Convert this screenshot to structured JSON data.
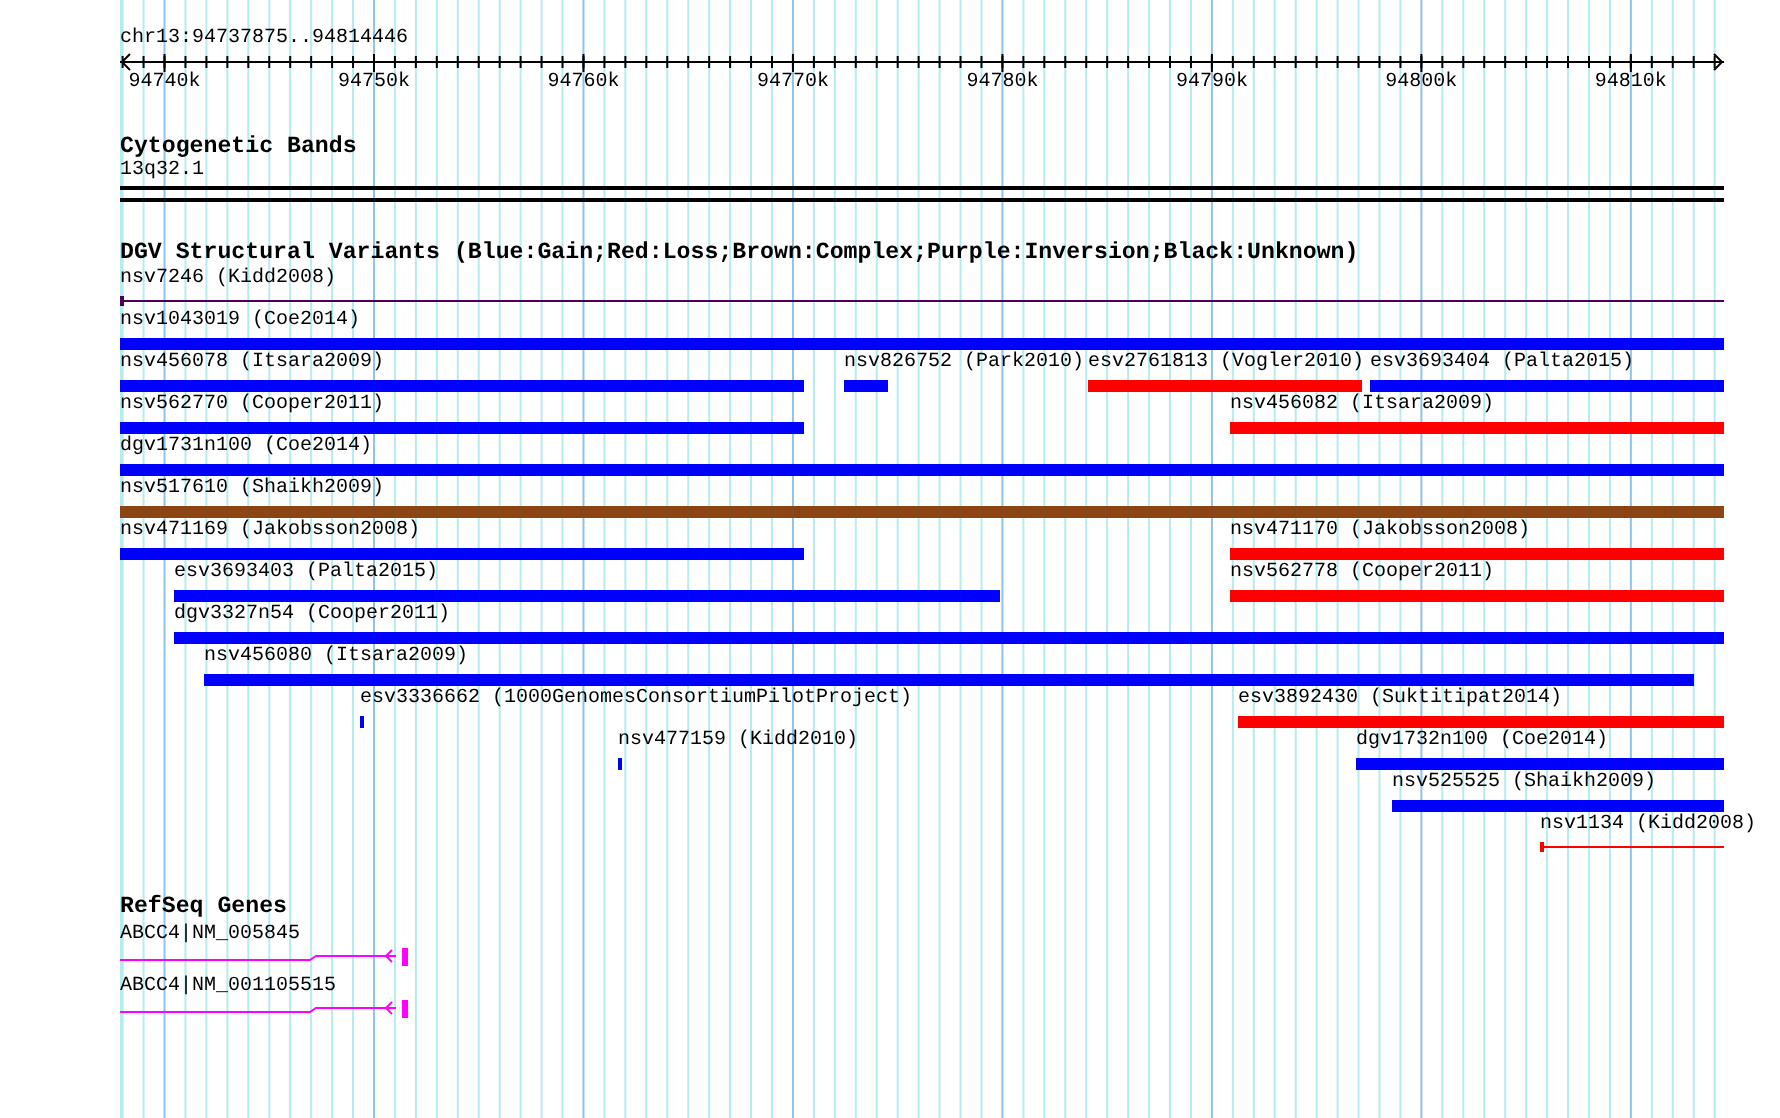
{
  "ruler": {
    "region": "chr13:94737875..94814446",
    "ticks": [
      {
        "label": "94740k"
      },
      {
        "label": "94750k"
      },
      {
        "label": "94760k"
      },
      {
        "label": "94770k"
      },
      {
        "label": "94780k"
      },
      {
        "label": "94790k"
      },
      {
        "label": "94800k"
      },
      {
        "label": "94810k"
      }
    ]
  },
  "cytogenetic_bands": {
    "title": "Cytogenetic Bands",
    "bands": [
      {
        "name": "13q32.1"
      }
    ]
  },
  "dgv": {
    "title": "DGV Structural Variants (Blue:Gain;Red:Loss;Brown:Complex;Purple:Inversion;Black:Unknown)",
    "rows": [
      {
        "features": [
          {
            "label": "nsv7246 (Kidd2008)",
            "kind": "line",
            "color": "#4b0055"
          }
        ]
      },
      {
        "features": [
          {
            "label": "nsv1043019 (Coe2014)",
            "kind": "bar",
            "color": "#0000ff"
          }
        ]
      },
      {
        "features": [
          {
            "label": "nsv456078 (Itsara2009)",
            "kind": "bar",
            "color": "#0000ff"
          },
          {
            "label": "nsv826752 (Park2010)",
            "kind": "bar",
            "color": "#0000ff"
          },
          {
            "label": "esv2761813 (Vogler2010)",
            "kind": "bar",
            "color": "#ff0000"
          },
          {
            "label": "esv3693404 (Palta2015)",
            "kind": "bar",
            "color": "#0000ff"
          }
        ]
      },
      {
        "features": [
          {
            "label": "nsv562770 (Cooper2011)",
            "kind": "bar",
            "color": "#0000ff"
          },
          {
            "label": "nsv456082 (Itsara2009)",
            "kind": "bar",
            "color": "#ff0000"
          }
        ]
      },
      {
        "features": [
          {
            "label": "dgv1731n100 (Coe2014)",
            "kind": "bar",
            "color": "#0000ff"
          }
        ]
      },
      {
        "features": [
          {
            "label": "nsv517610 (Shaikh2009)",
            "kind": "bar",
            "color": "#8b4513"
          }
        ]
      },
      {
        "features": [
          {
            "label": "nsv471169 (Jakobsson2008)",
            "kind": "bar",
            "color": "#0000ff"
          },
          {
            "label": "nsv471170 (Jakobsson2008)",
            "kind": "bar",
            "color": "#ff0000"
          }
        ]
      },
      {
        "features": [
          {
            "label": "esv3693403 (Palta2015)",
            "kind": "bar",
            "color": "#0000ff"
          },
          {
            "label": "nsv562778 (Cooper2011)",
            "kind": "bar",
            "color": "#ff0000"
          }
        ]
      },
      {
        "features": [
          {
            "label": "dgv3327n54 (Cooper2011)",
            "kind": "bar",
            "color": "#0000ff"
          }
        ]
      },
      {
        "features": [
          {
            "label": "nsv456080 (Itsara2009)",
            "kind": "bar",
            "color": "#0000ff"
          }
        ]
      },
      {
        "features": [
          {
            "label": "esv3336662 (1000GenomesConsortiumPilotProject)",
            "kind": "bar",
            "color": "#0000ff"
          },
          {
            "label": "esv3892430 (Suktitipat2014)",
            "kind": "bar",
            "color": "#ff0000"
          }
        ]
      },
      {
        "features": [
          {
            "label": "nsv477159 (Kidd2010)",
            "kind": "bar",
            "color": "#0000ff"
          },
          {
            "label": "dgv1732n100 (Coe2014)",
            "kind": "bar",
            "color": "#0000ff"
          }
        ]
      },
      {
        "features": [
          {
            "label": "nsv525525 (Shaikh2009)",
            "kind": "bar",
            "color": "#0000ff"
          }
        ]
      },
      {
        "features": [
          {
            "label": "nsv1134 (Kidd2008)",
            "kind": "line",
            "color": "#ff0000"
          }
        ]
      }
    ]
  },
  "refseq": {
    "title": "RefSeq Genes",
    "genes": [
      {
        "label": "ABCC4|NM_005845"
      },
      {
        "label": "ABCC4|NM_001105515"
      }
    ]
  }
}
